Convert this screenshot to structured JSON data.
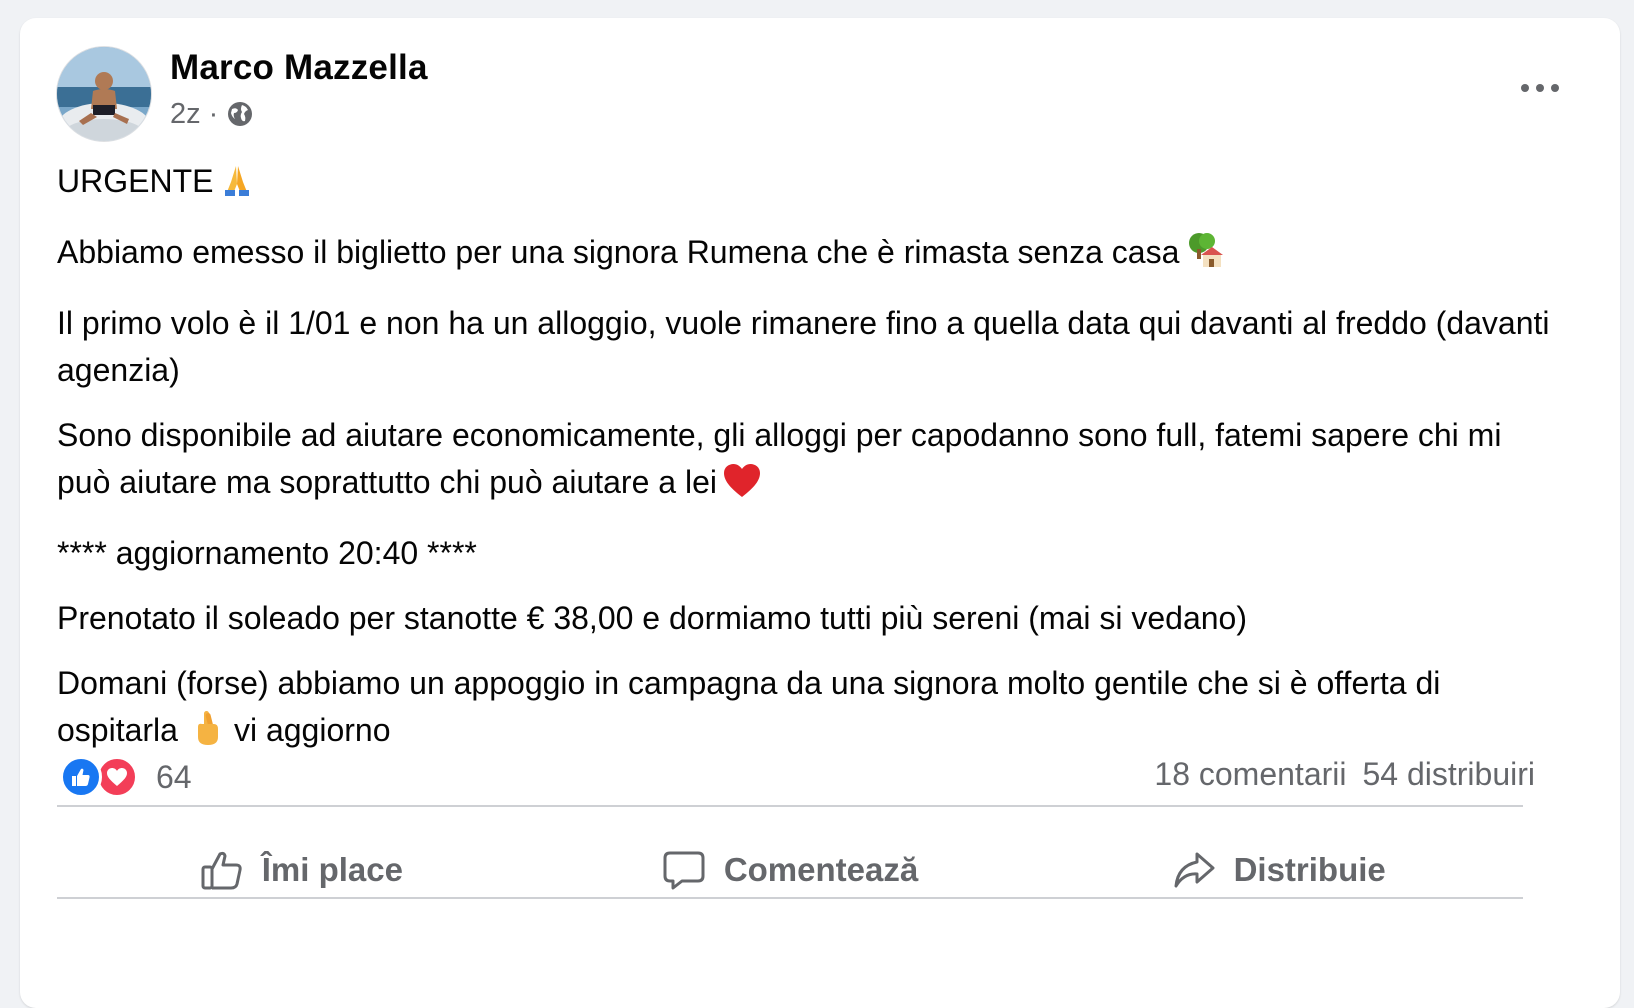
{
  "post": {
    "author": "Marco Mazzella",
    "time": "2z",
    "separator": "·",
    "paragraphs": [
      "URGENTE",
      "Abbiamo emesso il biglietto per una signora Rumena che è rimasta senza casa",
      "Il primo volo è il 1/01 e non ha un alloggio, vuole rimanere fino a quella data qui davanti al freddo (davanti agenzia)",
      "Sono disponibile ad aiutare economicamente, gli alloggi per capodanno sono full, fatemi sapere chi mi può aiutare ma soprattutto chi può aiutare a lei",
      "**** aggiornamento 20:40 ****",
      "Prenotato il soleado per stanotte € 38,00 e dormiamo tutti più sereni (mai si vedano)",
      "Domani (forse) abbiamo un appoggio in campagna da una signora molto gentile che si è offerta di ospitarla",
      "vi aggiorno"
    ]
  },
  "reactions": {
    "count": "64"
  },
  "stats": {
    "comments": "18 comentarii",
    "shares": "54 distribuiri"
  },
  "actions": {
    "like": "Îmi place",
    "comment": "Comentează",
    "share": "Distribuie"
  },
  "colors": {
    "like_blue": "#1877f2",
    "love_red": "#f33e58",
    "secondary_text": "#65676b",
    "background": "#f0f2f5"
  },
  "icons": [
    "globe-icon",
    "more-options-icon",
    "folded-hands-emoji",
    "house-tree-emoji",
    "red-heart-emoji",
    "crossed-fingers-emoji",
    "like-reaction-icon",
    "love-reaction-icon",
    "thumbs-up-icon",
    "comment-bubble-icon",
    "share-arrow-icon"
  ]
}
